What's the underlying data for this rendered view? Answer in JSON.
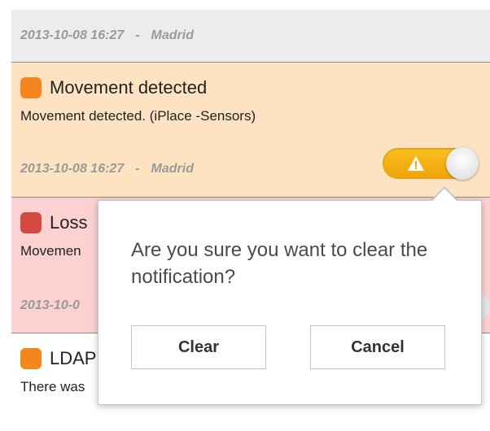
{
  "notifications": [
    {
      "meta_time": "2013-10-08 16:27",
      "meta_sep": "-",
      "meta_location": "Madrid"
    },
    {
      "title": "Movement detected",
      "description": "Movement detected. (iPlace -Sensors)",
      "meta_time": "2013-10-08 16:27",
      "meta_sep": "-",
      "meta_location": "Madrid",
      "status_color": "#f5861f"
    },
    {
      "title": "Loss",
      "description": "Movemen",
      "meta_time": "2013-10-0",
      "status_color": "#d44a40"
    },
    {
      "title": "LDAP",
      "description": "There was",
      "status_color": "#f5861f"
    }
  ],
  "toggle": {
    "icon": "warning-icon",
    "color": "#fbbf1e"
  },
  "dialog": {
    "question": "Are you sure you want to clear the notification?",
    "clear_label": "Clear",
    "cancel_label": "Cancel"
  }
}
